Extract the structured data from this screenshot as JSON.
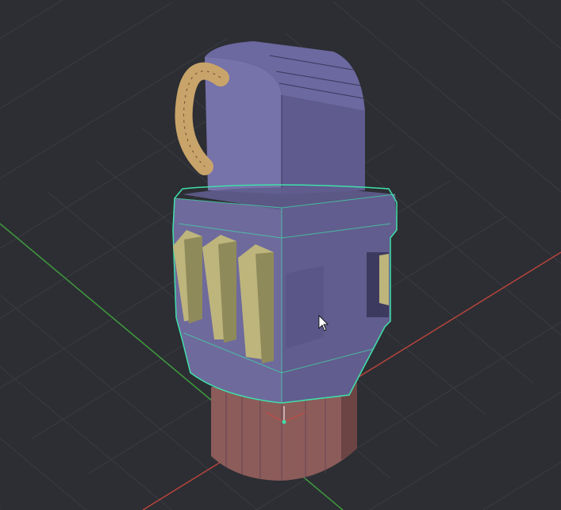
{
  "viewport": {
    "background": "#2c2e33",
    "grid_color": "#3a3c42",
    "x_axis_color": "#b8443c",
    "y_axis_color": "#3f9a3c",
    "selection_outline_color": "#3fe0a8",
    "cursor_icon": "arrow-cursor"
  },
  "model": {
    "head_front_color": "#7672aa",
    "head_side_color": "#5f5b8f",
    "head_top_color": "#6c68a0",
    "tube_color": "#c8a46a",
    "body_front_color": "#6e6a9c",
    "body_side_color": "#615d8e",
    "fin_color": "#bdb57c",
    "fin_side_color": "#8f8a5a",
    "base_color": "#8c5c5a",
    "base_dark_color": "#6c4444"
  }
}
